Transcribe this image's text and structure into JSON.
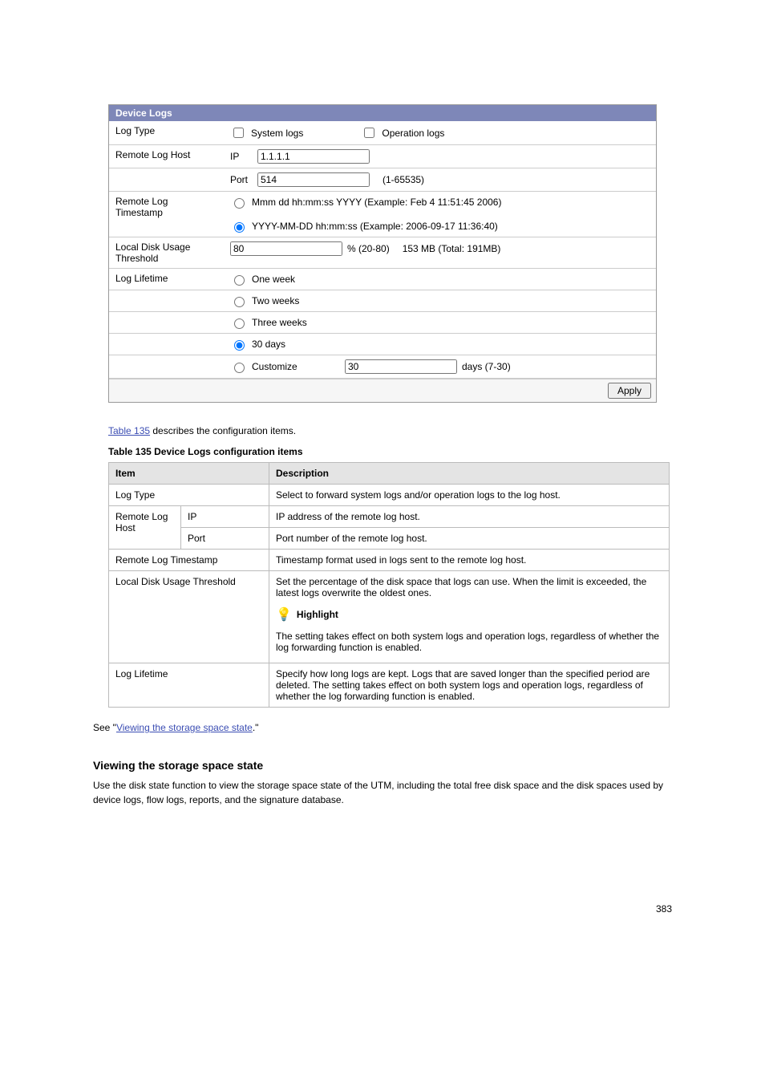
{
  "panel": {
    "title": "Device Logs",
    "logType": {
      "label": "Log Type",
      "systemLogs": "System logs",
      "operationLogs": "Operation logs"
    },
    "remoteHost": {
      "label": "Remote Log Host",
      "ipLabel": "IP",
      "ipValue": "1.1.1.1",
      "portLabel": "Port",
      "portValue": "514",
      "portRange": "(1-65535)"
    },
    "remoteTimestamp": {
      "label": "Remote Log Timestamp",
      "option1": "Mmm dd hh:mm:ss YYYY (Example: Feb 4 11:51:45 2006)",
      "option2": "YYYY-MM-DD hh:mm:ss (Example: 2006-09-17 11:36:40)"
    },
    "diskUsage": {
      "label": "Local Disk Usage Threshold",
      "value": "80",
      "suffix": "% (20-80)",
      "info": "153 MB (Total: 191MB)"
    },
    "lifetime": {
      "label": "Log Lifetime",
      "oneWeek": "One week",
      "twoWeeks": "Two weeks",
      "threeWeeks": "Three weeks",
      "thirtyDays": "30 days",
      "customize": "Customize",
      "customizeValue": "30",
      "customizeSuffix": "days (7-30)"
    },
    "applyLabel": "Apply"
  },
  "table": {
    "captionPrefix": "Table 135",
    "caption": " describes the configuration items.",
    "title": "Table 135 Device Logs configuration items",
    "headers": {
      "item": "Item",
      "desc": "Description"
    },
    "rows": {
      "logType": {
        "item": "Log Type",
        "desc": "Select to forward system logs and/or operation logs to the log host."
      },
      "remoteHostIp": {
        "item": "Remote Log Host",
        "sub": "IP",
        "desc": "IP address of the remote log host."
      },
      "remoteHostPort": {
        "sub": "Port",
        "desc": "Port number of the remote log host."
      },
      "remoteTimestamp": {
        "item": "Remote Log Timestamp",
        "desc": "Timestamp format used in logs sent to the remote log host."
      },
      "diskUsage": {
        "item": "Local Disk Usage Threshold",
        "desc1": "Set the percentage of the disk space that logs can use. When the limit is exceeded, the latest logs overwrite the oldest ones.",
        "highlightLabel": "Highlight",
        "desc2": "The setting takes effect on both system logs and operation logs, regardless of whether the log forwarding function is enabled."
      },
      "lifetime": {
        "item": "Log Lifetime",
        "desc": "Specify how long logs are kept. Logs that are saved longer than the specified period are deleted. The setting takes effect on both system logs and operation logs, regardless of whether the log forwarding function is enabled."
      }
    }
  },
  "section": {
    "seePrefix": "See \"",
    "linkText": "Viewing the storage space state",
    "seeSuffix": ".\"",
    "heading": "Viewing the storage space state",
    "para": "Use the disk state function to view the storage space state of the UTM, including the total free disk space and the disk spaces used by device logs, flow logs, reports, and the signature database."
  },
  "pageNumber": "383"
}
